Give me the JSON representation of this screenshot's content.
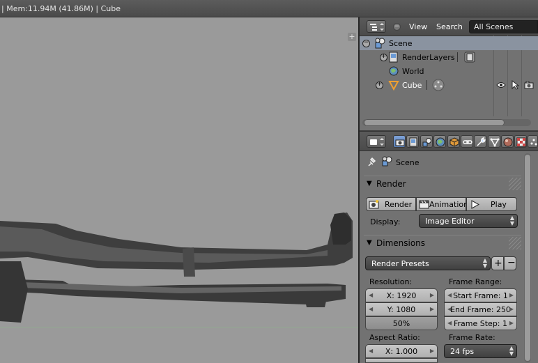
{
  "infobar": {
    "text": "| Mem:11.94M (41.86M) | Cube"
  },
  "viewport": {
    "object_description": ""
  },
  "outliner": {
    "menus": {
      "view": "View",
      "search": "Search"
    },
    "scenes_select": "All Scenes",
    "tree": [
      {
        "label": "Scene"
      },
      {
        "label": "RenderLayers"
      },
      {
        "label": "World"
      },
      {
        "label": "Cube"
      }
    ]
  },
  "properties": {
    "context_path": "Scene",
    "render_panel": {
      "title": "Render",
      "buttons": {
        "render": "Render",
        "animation": "Animation",
        "play": "Play"
      },
      "display_label": "Display:",
      "display_value": "Image Editor"
    },
    "dimensions_panel": {
      "title": "Dimensions",
      "presets": "Render Presets",
      "resolution_label": "Resolution:",
      "res_x": "X: 1920",
      "res_y": "Y: 1080",
      "res_percent": "50%",
      "frame_range_label": "Frame Range:",
      "start_frame": "Start Frame: 1",
      "end_frame": "End Frame: 250",
      "frame_step": "Frame Step: 1",
      "aspect_label": "Aspect Ratio:",
      "aspect_x": "X: 1.000",
      "frame_rate_label": "Frame Rate:",
      "frame_rate": "24 fps"
    }
  },
  "colors": {
    "accent_selected": "#7ea2d8",
    "viewport_bg": "#9a9a9a"
  }
}
